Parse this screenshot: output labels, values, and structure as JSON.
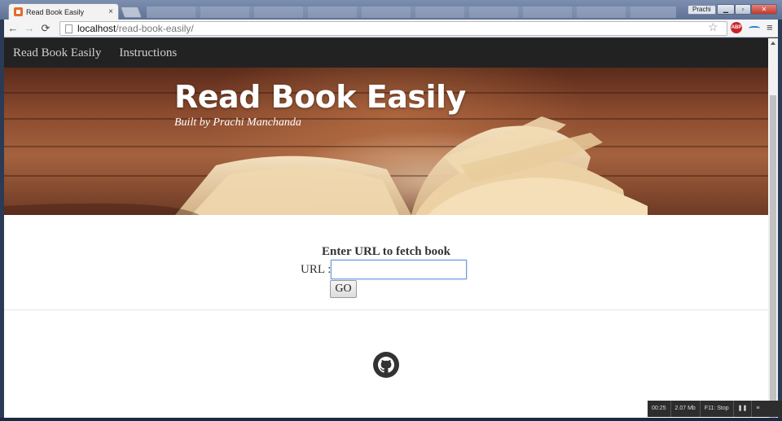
{
  "browser": {
    "tab_title": "Read Book Easily",
    "tab_close": "×",
    "user_label": "Prachi",
    "window_controls": {
      "minimize": "▁",
      "maximize": "▫",
      "close": "✕"
    },
    "url_host": "localhost",
    "url_path": "/read-book-easily/",
    "back_icon": "←",
    "forward_icon": "→",
    "reload_icon": "⟳",
    "star_icon": "☆",
    "abp_label": "ABP",
    "menu_icon": "≡"
  },
  "site_nav": {
    "brand": "Read Book Easily",
    "links": [
      "Instructions"
    ]
  },
  "hero": {
    "title": "Read Book Easily",
    "subtitle": "Built by Prachi Manchanda"
  },
  "form": {
    "heading": "Enter URL to fetch book",
    "url_label": "URL :",
    "url_value": "",
    "go_label": "GO"
  },
  "footer": {
    "icon": "github-icon"
  },
  "recorder": {
    "time": "00:25",
    "size": "2.07 Mb",
    "stop_label": "F11: Stop",
    "pause_icon": "❚❚",
    "menu_icon": "≡"
  }
}
